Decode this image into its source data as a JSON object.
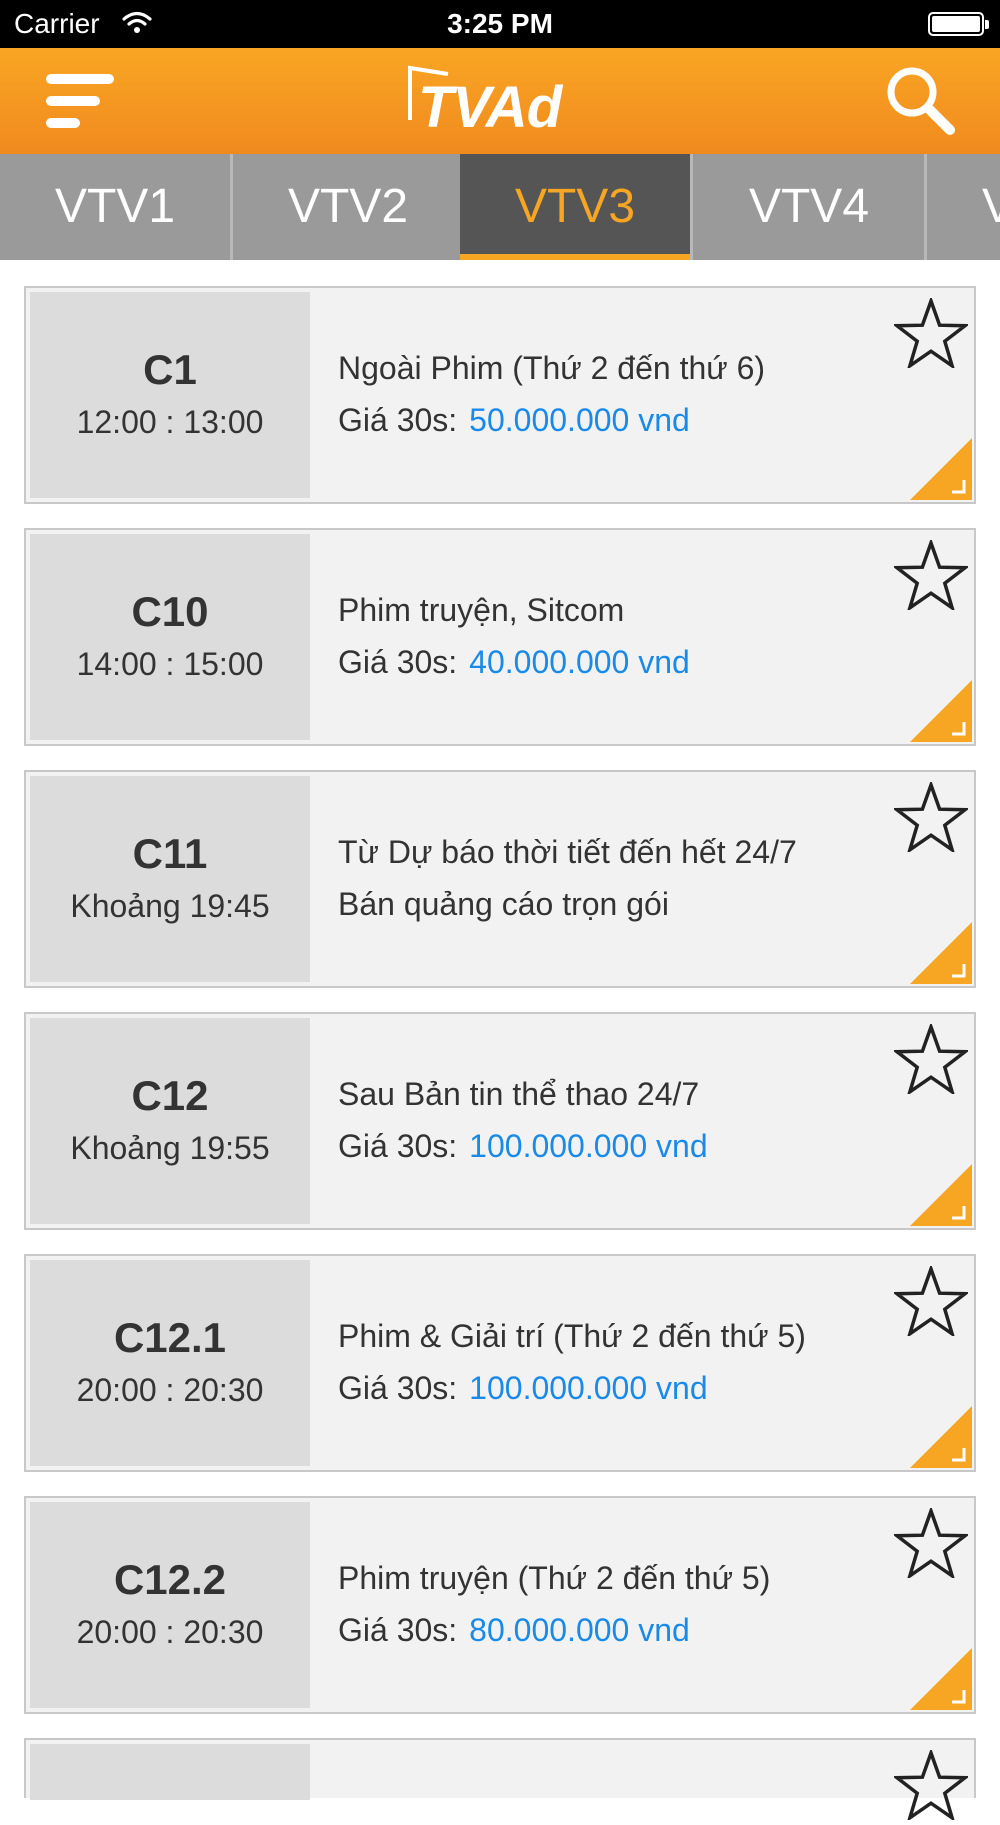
{
  "status_bar": {
    "carrier": "Carrier",
    "time": "3:25 PM"
  },
  "header": {
    "logo": "TVAd",
    "menu_icon": "hamburger-menu-icon",
    "search_icon": "search-icon"
  },
  "tabs": [
    {
      "label": "VTV1",
      "active": false
    },
    {
      "label": "VTV2",
      "active": false
    },
    {
      "label": "VTV3",
      "active": true
    },
    {
      "label": "VTV4",
      "active": false
    },
    {
      "label": "V",
      "active": false
    }
  ],
  "colors": {
    "accent": "#f6a623",
    "price": "#1a8ae8",
    "tab_bg": "#9a9a9a",
    "tab_active_bg": "#555555"
  },
  "slots": [
    {
      "code": "C1",
      "time": "12:00 : 13:00",
      "title": "Ngoài Phim (Thứ 2 đến thứ 6)",
      "price_label": "Giá 30s:",
      "price": "50.000.000 vnd"
    },
    {
      "code": "C10",
      "time": "14:00 : 15:00",
      "title": "Phim truyện, Sitcom",
      "price_label": "Giá 30s:",
      "price": "40.000.000 vnd"
    },
    {
      "code": "C11",
      "time": "Khoảng 19:45",
      "title": "Từ Dự báo thời tiết đến hết 24/7",
      "note": "Bán quảng cáo trọn gói"
    },
    {
      "code": "C12",
      "time": "Khoảng 19:55",
      "title": "Sau Bản tin thể thao 24/7",
      "price_label": "Giá 30s:",
      "price": "100.000.000 vnd"
    },
    {
      "code": "C12.1",
      "time": "20:00 : 20:30",
      "title": "Phim & Giải trí (Thứ 2 đến thứ 5)",
      "price_label": "Giá 30s:",
      "price": "100.000.000 vnd"
    },
    {
      "code": "C12.2",
      "time": "20:00 : 20:30",
      "title": "Phim truyện (Thứ 2 đến thứ 5)",
      "price_label": "Giá 30s:",
      "price": "80.000.000 vnd"
    },
    {
      "code": "",
      "time": "",
      "title": ""
    }
  ]
}
